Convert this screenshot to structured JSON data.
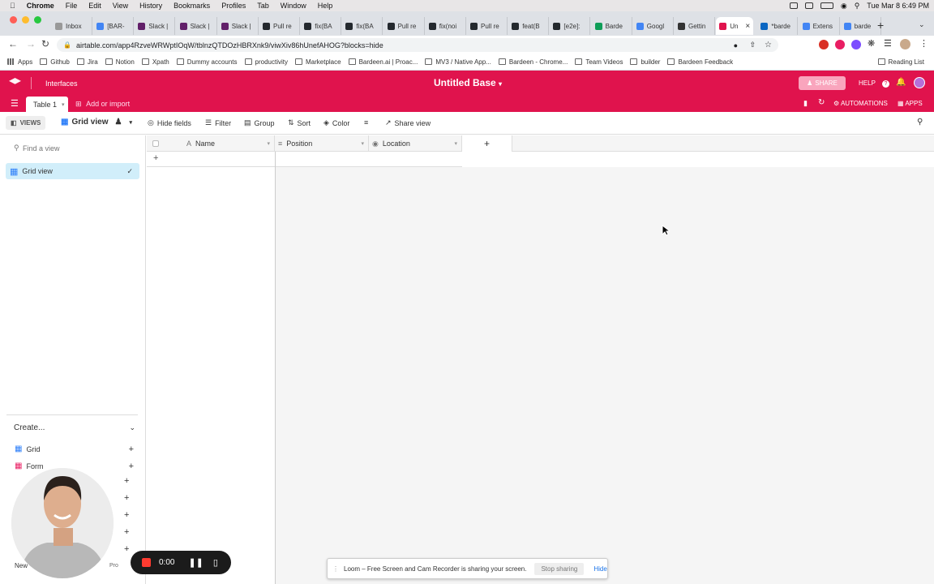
{
  "menubar": {
    "app": "Chrome",
    "items": [
      "File",
      "Edit",
      "View",
      "History",
      "Bookmarks",
      "Profiles",
      "Tab",
      "Window",
      "Help"
    ],
    "clock": "Tue Mar 8  6:49 PM"
  },
  "tabs": [
    "Inbox",
    "[BAR-",
    "Slack |",
    "Slack |",
    "Slack |",
    "Pull re",
    "fix(BA",
    "fix(BA",
    "Pull re",
    "fix(noi",
    "Pull re",
    "feat(B",
    "[e2e]:",
    "Barde",
    "Googl",
    "Gettin",
    "Un",
    "*barde",
    "Extens",
    "barde"
  ],
  "address": {
    "url": "airtable.com/app4RzveWRWptIOqW/tblnzQTDOzHBRXnk9/viwXiv86hUnefAHOG?blocks=hide"
  },
  "bookmarks": [
    "Apps",
    "Github",
    "Jira",
    "Notion",
    "Xpath",
    "Dummy accounts",
    "productivity",
    "Marketplace",
    "Bardeen.ai | Proac...",
    "MV3 / Native App...",
    "Bardeen - Chrome...",
    "Team Videos",
    "builder",
    "Bardeen Feedback"
  ],
  "reading_list": "Reading List",
  "header": {
    "interfaces": "Interfaces",
    "base_title": "Untitled Base",
    "share": "SHARE",
    "help": "HELP",
    "automations": "AUTOMATIONS",
    "apps": "APPS",
    "table_tab": "Table 1",
    "add_import": "Add or import",
    "brand_color": "#e0134d"
  },
  "toolbar": {
    "views": "VIEWS",
    "view_name": "Grid view",
    "hide_fields": "Hide fields",
    "filter": "Filter",
    "group": "Group",
    "sort": "Sort",
    "color": "Color",
    "share_view": "Share view"
  },
  "sidebar": {
    "find_placeholder": "Find a view",
    "active_view": "Grid view",
    "create": "Create...",
    "create_items": [
      "Grid",
      "Form"
    ],
    "new_label": "New",
    "pro": "Pro"
  },
  "grid": {
    "columns": [
      "Name",
      "Position",
      "Location"
    ],
    "add_row": "+"
  },
  "loom": {
    "message": "Loom – Free Screen and Cam Recorder is sharing your screen.",
    "stop": "Stop sharing",
    "hide": "Hide",
    "timer": "0:00"
  }
}
